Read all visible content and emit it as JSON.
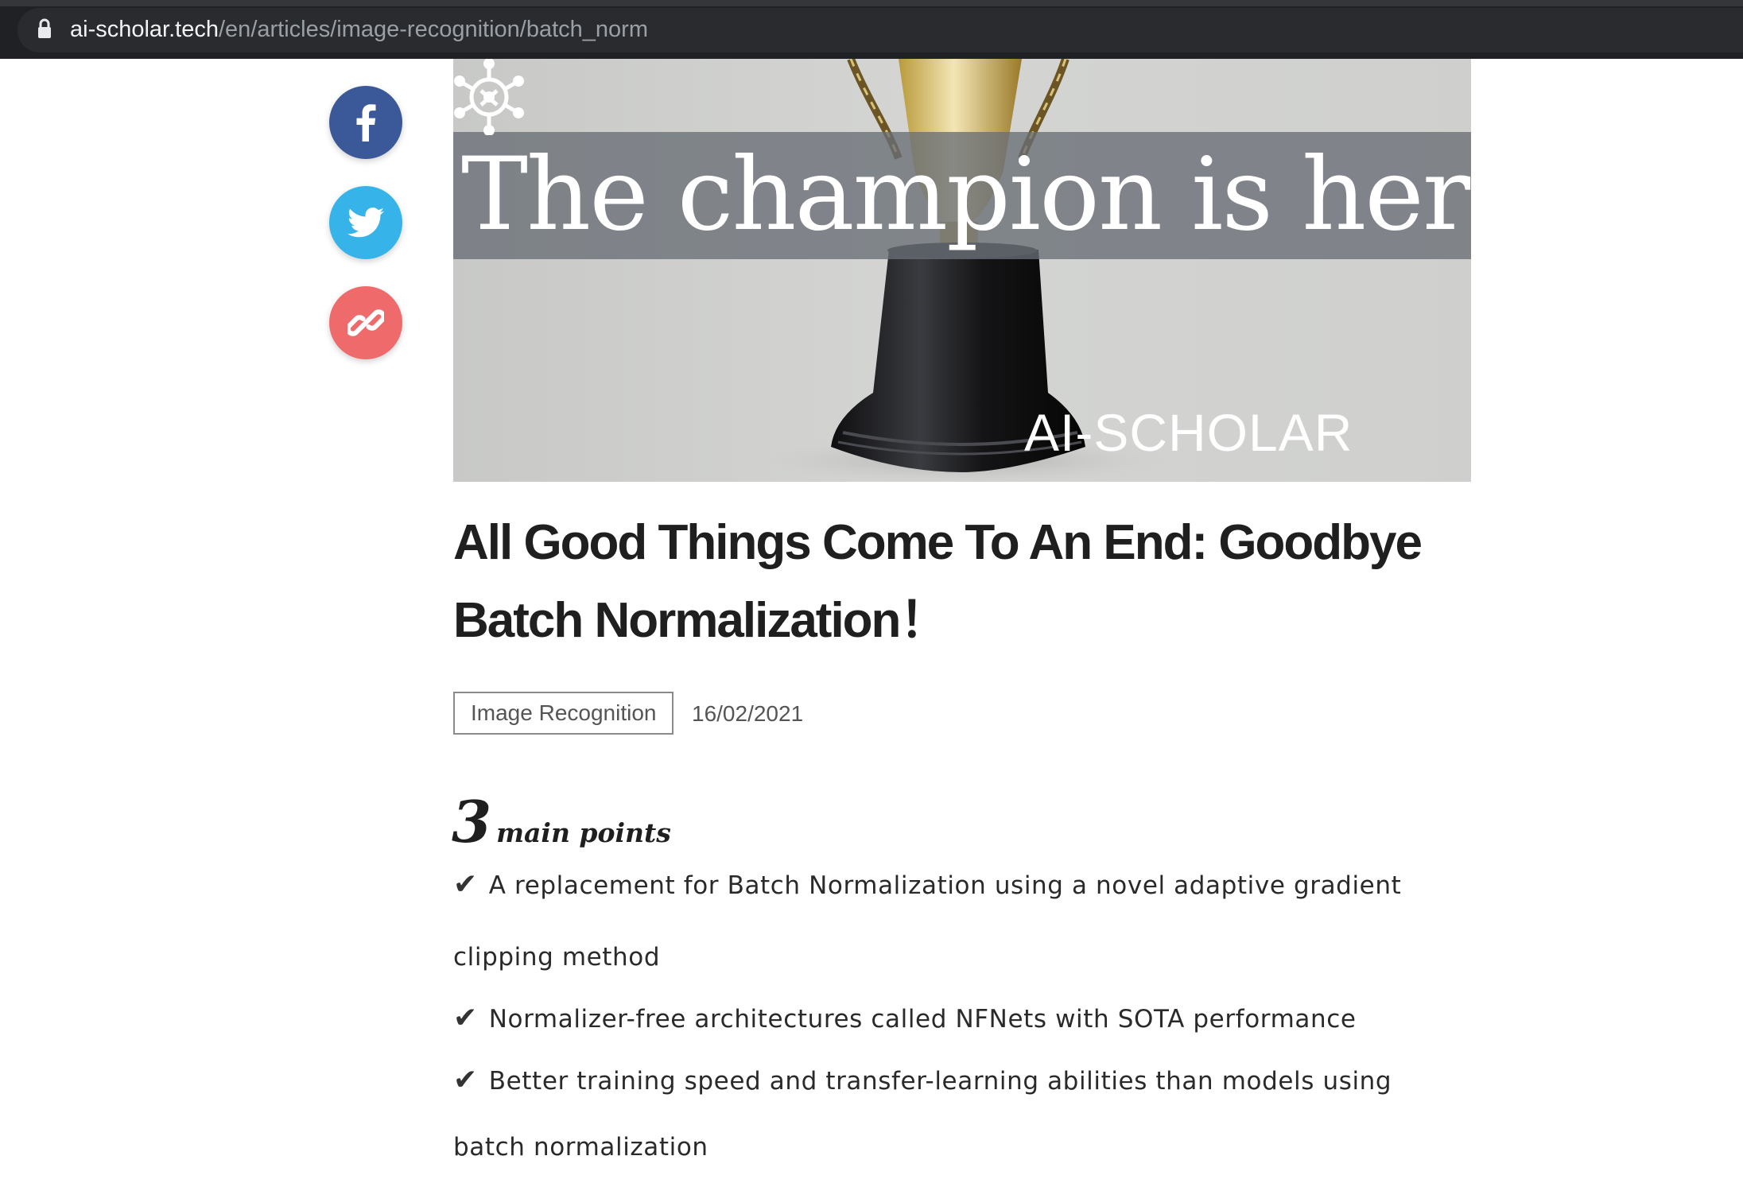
{
  "browser": {
    "url_host": "ai-scholar.tech",
    "url_path": "/en/articles/image-recognition/batch_norm"
  },
  "share": {
    "facebook_icon": "facebook-icon",
    "twitter_icon": "twitter-icon",
    "link_icon": "link-icon",
    "colors": {
      "facebook": "#3b5998",
      "twitter": "#36b3e8",
      "link": "#ef6b6b"
    }
  },
  "hero": {
    "title": "The champion is here",
    "brand": "AI-SCHOLAR"
  },
  "article": {
    "title_line1": "All Good Things Come To An End: Goodbye",
    "title_line2": "Batch Normalization！",
    "category": "Image Recognition",
    "date": "16/02/2021"
  },
  "main_points": {
    "number": "3",
    "label": "main points",
    "check": "✔",
    "items": [
      {
        "line1": "A replacement for Batch Normalization using a novel adaptive gradient",
        "line2": "clipping method"
      },
      {
        "line1": "Normalizer-free architectures called NFNets with SOTA performance"
      },
      {
        "line1": "Better training speed and transfer-learning abilities than models using",
        "line2": "batch normalization"
      }
    ]
  }
}
